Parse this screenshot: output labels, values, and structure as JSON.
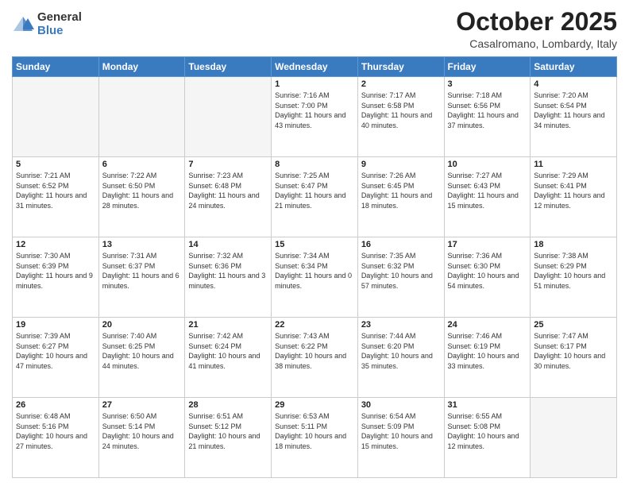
{
  "header": {
    "logo_general": "General",
    "logo_blue": "Blue",
    "month_title": "October 2025",
    "location": "Casalromano, Lombardy, Italy"
  },
  "days_of_week": [
    "Sunday",
    "Monday",
    "Tuesday",
    "Wednesday",
    "Thursday",
    "Friday",
    "Saturday"
  ],
  "weeks": [
    [
      {
        "day": "",
        "sunrise": "",
        "sunset": "",
        "daylight": ""
      },
      {
        "day": "",
        "sunrise": "",
        "sunset": "",
        "daylight": ""
      },
      {
        "day": "",
        "sunrise": "",
        "sunset": "",
        "daylight": ""
      },
      {
        "day": "1",
        "sunrise": "Sunrise: 7:16 AM",
        "sunset": "Sunset: 7:00 PM",
        "daylight": "Daylight: 11 hours and 43 minutes."
      },
      {
        "day": "2",
        "sunrise": "Sunrise: 7:17 AM",
        "sunset": "Sunset: 6:58 PM",
        "daylight": "Daylight: 11 hours and 40 minutes."
      },
      {
        "day": "3",
        "sunrise": "Sunrise: 7:18 AM",
        "sunset": "Sunset: 6:56 PM",
        "daylight": "Daylight: 11 hours and 37 minutes."
      },
      {
        "day": "4",
        "sunrise": "Sunrise: 7:20 AM",
        "sunset": "Sunset: 6:54 PM",
        "daylight": "Daylight: 11 hours and 34 minutes."
      }
    ],
    [
      {
        "day": "5",
        "sunrise": "Sunrise: 7:21 AM",
        "sunset": "Sunset: 6:52 PM",
        "daylight": "Daylight: 11 hours and 31 minutes."
      },
      {
        "day": "6",
        "sunrise": "Sunrise: 7:22 AM",
        "sunset": "Sunset: 6:50 PM",
        "daylight": "Daylight: 11 hours and 28 minutes."
      },
      {
        "day": "7",
        "sunrise": "Sunrise: 7:23 AM",
        "sunset": "Sunset: 6:48 PM",
        "daylight": "Daylight: 11 hours and 24 minutes."
      },
      {
        "day": "8",
        "sunrise": "Sunrise: 7:25 AM",
        "sunset": "Sunset: 6:47 PM",
        "daylight": "Daylight: 11 hours and 21 minutes."
      },
      {
        "day": "9",
        "sunrise": "Sunrise: 7:26 AM",
        "sunset": "Sunset: 6:45 PM",
        "daylight": "Daylight: 11 hours and 18 minutes."
      },
      {
        "day": "10",
        "sunrise": "Sunrise: 7:27 AM",
        "sunset": "Sunset: 6:43 PM",
        "daylight": "Daylight: 11 hours and 15 minutes."
      },
      {
        "day": "11",
        "sunrise": "Sunrise: 7:29 AM",
        "sunset": "Sunset: 6:41 PM",
        "daylight": "Daylight: 11 hours and 12 minutes."
      }
    ],
    [
      {
        "day": "12",
        "sunrise": "Sunrise: 7:30 AM",
        "sunset": "Sunset: 6:39 PM",
        "daylight": "Daylight: 11 hours and 9 minutes."
      },
      {
        "day": "13",
        "sunrise": "Sunrise: 7:31 AM",
        "sunset": "Sunset: 6:37 PM",
        "daylight": "Daylight: 11 hours and 6 minutes."
      },
      {
        "day": "14",
        "sunrise": "Sunrise: 7:32 AM",
        "sunset": "Sunset: 6:36 PM",
        "daylight": "Daylight: 11 hours and 3 minutes."
      },
      {
        "day": "15",
        "sunrise": "Sunrise: 7:34 AM",
        "sunset": "Sunset: 6:34 PM",
        "daylight": "Daylight: 11 hours and 0 minutes."
      },
      {
        "day": "16",
        "sunrise": "Sunrise: 7:35 AM",
        "sunset": "Sunset: 6:32 PM",
        "daylight": "Daylight: 10 hours and 57 minutes."
      },
      {
        "day": "17",
        "sunrise": "Sunrise: 7:36 AM",
        "sunset": "Sunset: 6:30 PM",
        "daylight": "Daylight: 10 hours and 54 minutes."
      },
      {
        "day": "18",
        "sunrise": "Sunrise: 7:38 AM",
        "sunset": "Sunset: 6:29 PM",
        "daylight": "Daylight: 10 hours and 51 minutes."
      }
    ],
    [
      {
        "day": "19",
        "sunrise": "Sunrise: 7:39 AM",
        "sunset": "Sunset: 6:27 PM",
        "daylight": "Daylight: 10 hours and 47 minutes."
      },
      {
        "day": "20",
        "sunrise": "Sunrise: 7:40 AM",
        "sunset": "Sunset: 6:25 PM",
        "daylight": "Daylight: 10 hours and 44 minutes."
      },
      {
        "day": "21",
        "sunrise": "Sunrise: 7:42 AM",
        "sunset": "Sunset: 6:24 PM",
        "daylight": "Daylight: 10 hours and 41 minutes."
      },
      {
        "day": "22",
        "sunrise": "Sunrise: 7:43 AM",
        "sunset": "Sunset: 6:22 PM",
        "daylight": "Daylight: 10 hours and 38 minutes."
      },
      {
        "day": "23",
        "sunrise": "Sunrise: 7:44 AM",
        "sunset": "Sunset: 6:20 PM",
        "daylight": "Daylight: 10 hours and 35 minutes."
      },
      {
        "day": "24",
        "sunrise": "Sunrise: 7:46 AM",
        "sunset": "Sunset: 6:19 PM",
        "daylight": "Daylight: 10 hours and 33 minutes."
      },
      {
        "day": "25",
        "sunrise": "Sunrise: 7:47 AM",
        "sunset": "Sunset: 6:17 PM",
        "daylight": "Daylight: 10 hours and 30 minutes."
      }
    ],
    [
      {
        "day": "26",
        "sunrise": "Sunrise: 6:48 AM",
        "sunset": "Sunset: 5:16 PM",
        "daylight": "Daylight: 10 hours and 27 minutes."
      },
      {
        "day": "27",
        "sunrise": "Sunrise: 6:50 AM",
        "sunset": "Sunset: 5:14 PM",
        "daylight": "Daylight: 10 hours and 24 minutes."
      },
      {
        "day": "28",
        "sunrise": "Sunrise: 6:51 AM",
        "sunset": "Sunset: 5:12 PM",
        "daylight": "Daylight: 10 hours and 21 minutes."
      },
      {
        "day": "29",
        "sunrise": "Sunrise: 6:53 AM",
        "sunset": "Sunset: 5:11 PM",
        "daylight": "Daylight: 10 hours and 18 minutes."
      },
      {
        "day": "30",
        "sunrise": "Sunrise: 6:54 AM",
        "sunset": "Sunset: 5:09 PM",
        "daylight": "Daylight: 10 hours and 15 minutes."
      },
      {
        "day": "31",
        "sunrise": "Sunrise: 6:55 AM",
        "sunset": "Sunset: 5:08 PM",
        "daylight": "Daylight: 10 hours and 12 minutes."
      },
      {
        "day": "",
        "sunrise": "",
        "sunset": "",
        "daylight": ""
      }
    ]
  ]
}
